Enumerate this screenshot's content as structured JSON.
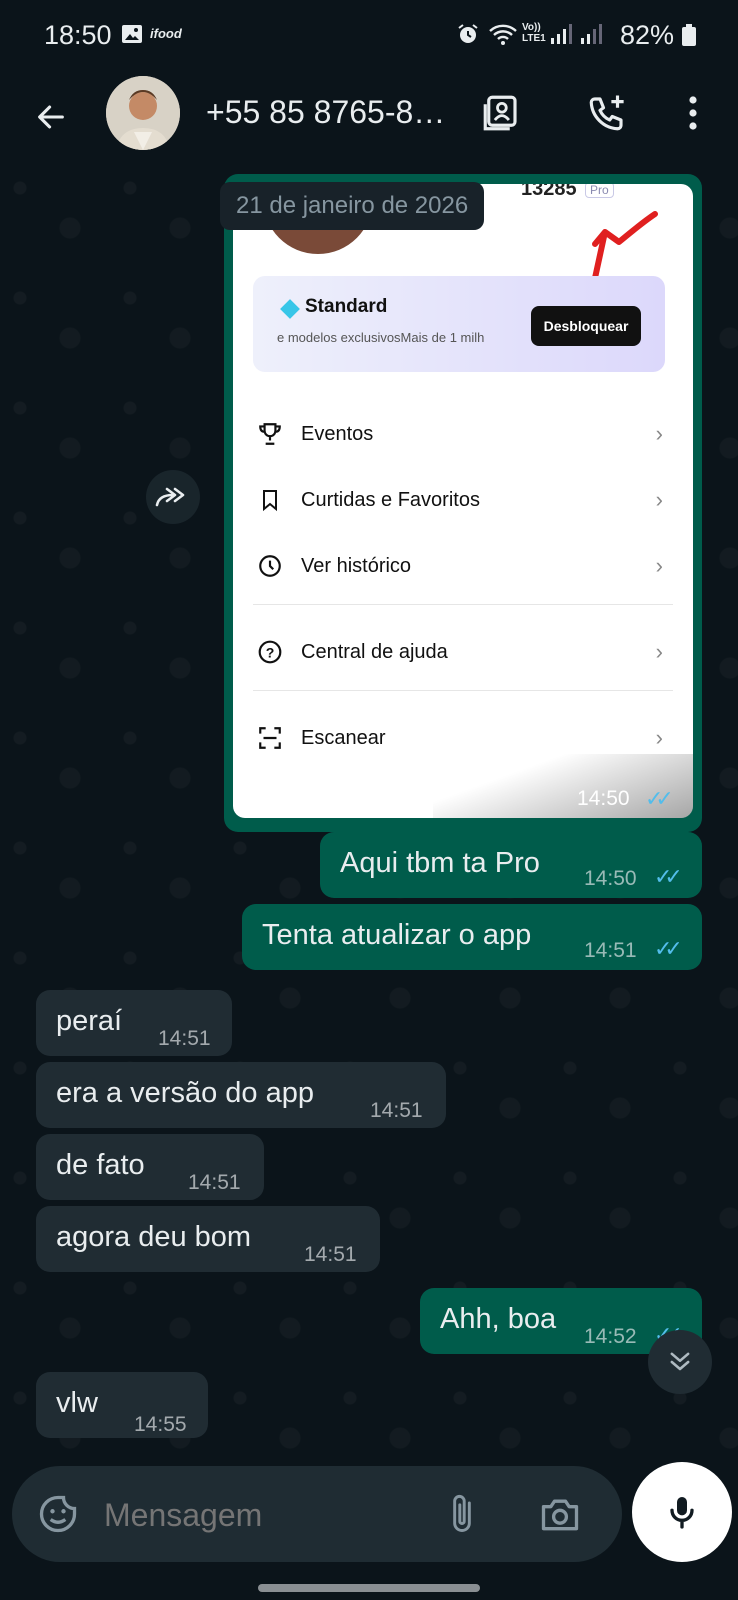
{
  "status_bar": {
    "time": "18:50",
    "app_badge": "ifood",
    "network": "LTE1",
    "volte": "Vo))",
    "battery": "82%"
  },
  "header": {
    "contact": "+55 85 8765-8…"
  },
  "chat": {
    "date_pill": "21 de janeiro de 2026",
    "shared_image": {
      "user_suffix": "13285",
      "pro_badge": "Pro",
      "plan_title": "Standard",
      "plan_sub": "e modelos exclusivosMais de 1 milh",
      "unlock_button": "Desbloquear",
      "menu": [
        "Eventos",
        "Curtidas e Favoritos",
        "Ver histórico",
        "Central de ajuda",
        "Escanear"
      ],
      "time": "14:50"
    },
    "messages": [
      {
        "dir": "out",
        "text": "Aqui tbm ta Pro",
        "time": "14:50"
      },
      {
        "dir": "out",
        "text": "Tenta atualizar o app",
        "time": "14:51"
      },
      {
        "dir": "in",
        "text": "peraí",
        "time": "14:51"
      },
      {
        "dir": "in",
        "text": "era a versão do app",
        "time": "14:51"
      },
      {
        "dir": "in",
        "text": "de fato",
        "time": "14:51"
      },
      {
        "dir": "in",
        "text": "agora deu bom",
        "time": "14:51"
      },
      {
        "dir": "out",
        "text": "Ahh, boa",
        "time": "14:52"
      },
      {
        "dir": "in",
        "text": "vlw",
        "time": "14:55"
      }
    ]
  },
  "composer": {
    "placeholder": "Mensagem"
  },
  "colors": {
    "bg": "#0b141a",
    "outgoing": "#005c4b",
    "incoming": "#202c33",
    "read_tick": "#53bdeb"
  },
  "icons": [
    "back-arrow-icon",
    "contacts-icon",
    "add-call-icon",
    "more-vert-icon",
    "forward-icon",
    "scroll-down-icon",
    "sticker-icon",
    "attach-icon",
    "camera-icon",
    "mic-icon"
  ]
}
